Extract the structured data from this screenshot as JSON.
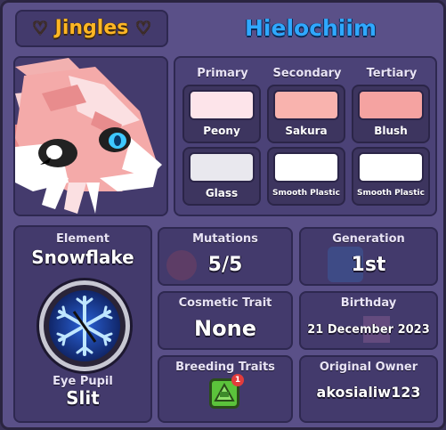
{
  "header": {
    "pet_name": "Jingles",
    "heart_symbol": "♡",
    "owner_display": "Hielochiim"
  },
  "colors": {
    "columns": [
      {
        "label": "Primary"
      },
      {
        "label": "Secondary"
      },
      {
        "label": "Tertiary"
      }
    ],
    "swatches": [
      {
        "name": "Peony",
        "hex": "#fde4ea"
      },
      {
        "name": "Sakura",
        "hex": "#f9b3ae"
      },
      {
        "name": "Blush",
        "hex": "#f5a3a1"
      },
      {
        "name": "Glass",
        "hex": "#e9e8ee"
      },
      {
        "name": "Smooth Plastic",
        "hex": "#ffffff"
      },
      {
        "name": "Smooth Plastic",
        "hex": "#ffffff"
      }
    ]
  },
  "element": {
    "label": "Element",
    "value": "Snowflake",
    "icon": "snowflake-icon",
    "eye_label": "Eye Pupil",
    "eye_value": "Slit"
  },
  "stats": {
    "mutations_label": "Mutations",
    "mutations_value": "5/5",
    "generation_label": "Generation",
    "generation_value": "1st",
    "cosmetic_label": "Cosmetic Trait",
    "cosmetic_value": "None",
    "birthday_label": "Birthday",
    "birthday_value": "21 December 2023",
    "breeding_label": "Breeding Traits",
    "breeding_badge": "1",
    "owner_label": "Original Owner",
    "owner_value": "akosialiw123"
  },
  "accent": {
    "name_gold": "#ffb624",
    "player_blue": "#2fa8ff",
    "panel": "#5a5088"
  }
}
